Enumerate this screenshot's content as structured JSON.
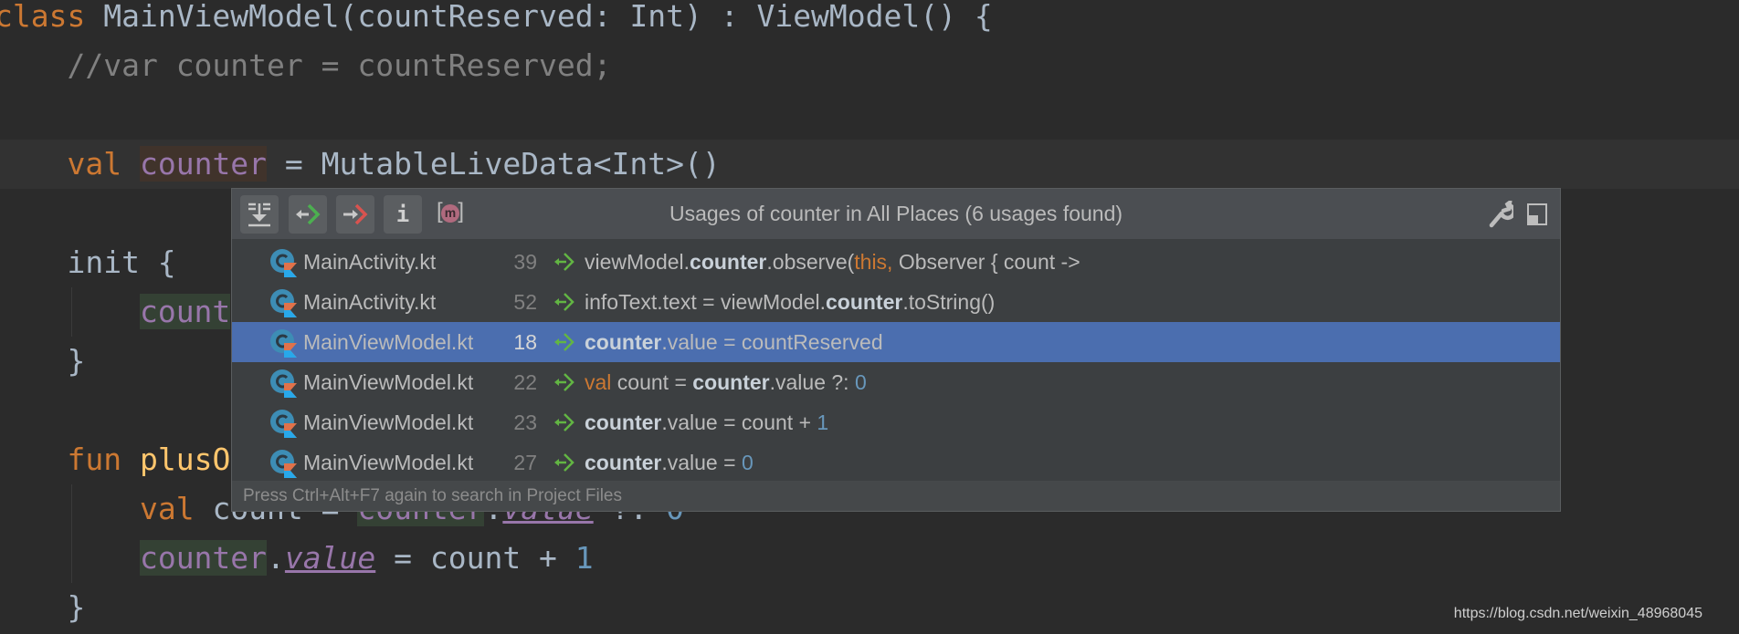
{
  "editor": {
    "lines": [
      {
        "segments": [
          {
            "t": "class ",
            "c": "kw"
          },
          {
            "t": "MainViewModel(countReserved: Int) : ViewModel() {",
            "c": ""
          }
        ]
      },
      {
        "segments": [
          {
            "t": "    ",
            "c": ""
          },
          {
            "t": "//var counter = countReserved;",
            "c": "cmt"
          }
        ]
      },
      {
        "segments": []
      },
      {
        "current": true,
        "segments": [
          {
            "t": "    ",
            "c": ""
          },
          {
            "t": "val ",
            "c": "kw"
          },
          {
            "t": "counter",
            "c": "prop decl"
          },
          {
            "t": " = MutableLiveData<Int>()",
            "c": ""
          }
        ]
      },
      {
        "segments": []
      },
      {
        "segments": [
          {
            "t": "    init {",
            "c": ""
          }
        ]
      },
      {
        "segments": [
          {
            "t": "        ",
            "c": ""
          },
          {
            "t": "count",
            "c": "prop use"
          }
        ]
      },
      {
        "segments": [
          {
            "t": "    }",
            "c": ""
          }
        ]
      },
      {
        "segments": []
      },
      {
        "segments": [
          {
            "t": "    ",
            "c": ""
          },
          {
            "t": "fun ",
            "c": "kw"
          },
          {
            "t": "plusO",
            "c": "fn"
          }
        ]
      },
      {
        "segments": [
          {
            "t": "        ",
            "c": ""
          },
          {
            "t": "val ",
            "c": "kw"
          },
          {
            "t": "count = ",
            "c": ""
          },
          {
            "t": "counter",
            "c": "prop use"
          },
          {
            "t": ".",
            "c": ""
          },
          {
            "t": "value",
            "c": "prop ital"
          },
          {
            "t": " ?: ",
            "c": ""
          },
          {
            "t": "0",
            "c": "num"
          }
        ]
      },
      {
        "segments": [
          {
            "t": "        ",
            "c": ""
          },
          {
            "t": "counter",
            "c": "prop use"
          },
          {
            "t": ".",
            "c": ""
          },
          {
            "t": "value",
            "c": "prop ital"
          },
          {
            "t": " = count + ",
            "c": ""
          },
          {
            "t": "1",
            "c": "num"
          }
        ]
      },
      {
        "segments": [
          {
            "t": "    }",
            "c": ""
          }
        ]
      }
    ]
  },
  "popup": {
    "title": "Usages of counter in All Places (6 usages found)",
    "toolbar": [
      "merge-usages-icon",
      "previous-occurrence-icon",
      "next-occurrence-icon",
      "info-icon",
      "method-filter-icon"
    ],
    "info_label": "i",
    "method_label": "m",
    "rows": [
      {
        "file": "MainActivity.kt",
        "line": "39",
        "selected": false,
        "segments": [
          {
            "t": "viewModel.",
            "c": ""
          },
          {
            "t": "counter",
            "c": "b"
          },
          {
            "t": ".observe(",
            "c": ""
          },
          {
            "t": "this,",
            "c": "o"
          },
          {
            "t": " Observer { count ->",
            "c": ""
          }
        ]
      },
      {
        "file": "MainActivity.kt",
        "line": "52",
        "selected": false,
        "segments": [
          {
            "t": "infoText.text = viewModel.",
            "c": ""
          },
          {
            "t": "counter",
            "c": "b"
          },
          {
            "t": ".toString()",
            "c": ""
          }
        ]
      },
      {
        "file": "MainViewModel.kt",
        "line": "18",
        "selected": true,
        "segments": [
          {
            "t": "counter",
            "c": "b"
          },
          {
            "t": ".value = countReserved",
            "c": ""
          }
        ]
      },
      {
        "file": "MainViewModel.kt",
        "line": "22",
        "selected": false,
        "segments": [
          {
            "t": "val",
            "c": "o"
          },
          {
            "t": " count = ",
            "c": ""
          },
          {
            "t": "counter",
            "c": "b"
          },
          {
            "t": ".value ?: ",
            "c": ""
          },
          {
            "t": "0",
            "c": "n"
          }
        ]
      },
      {
        "file": "MainViewModel.kt",
        "line": "23",
        "selected": false,
        "segments": [
          {
            "t": "counter",
            "c": "b"
          },
          {
            "t": ".value = count + ",
            "c": ""
          },
          {
            "t": "1",
            "c": "n"
          }
        ]
      },
      {
        "file": "MainViewModel.kt",
        "line": "27",
        "selected": false,
        "segments": [
          {
            "t": "counter",
            "c": "b"
          },
          {
            "t": ".value = ",
            "c": ""
          },
          {
            "t": "0",
            "c": "n"
          }
        ]
      }
    ],
    "footer": "Press Ctrl+Alt+F7 again to search in Project Files"
  },
  "watermark": "https://blog.csdn.net/weixin_48968045",
  "colors": {
    "background": "#2b2b2b",
    "selection": "#4b6eaf",
    "keyword": "#cc7832",
    "property": "#9876aa",
    "number": "#6897bb"
  }
}
